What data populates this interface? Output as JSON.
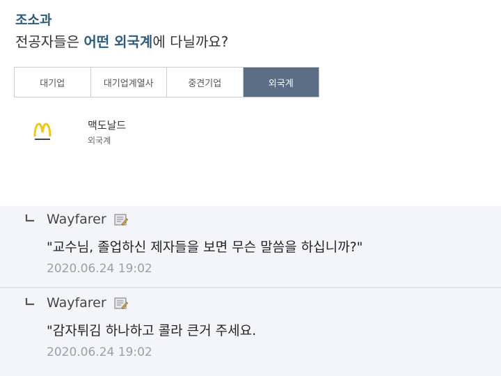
{
  "header": {
    "department": "조소과",
    "question_prefix": "전공자들은 ",
    "question_highlight": "어떤 외국계",
    "question_suffix": "에 다닐까요?"
  },
  "tabs": [
    {
      "label": "대기업",
      "active": false
    },
    {
      "label": "대기업계열사",
      "active": false
    },
    {
      "label": "중견기업",
      "active": false
    },
    {
      "label": "외국계",
      "active": true
    }
  ],
  "company": {
    "name": "맥도날드",
    "type": "외국계",
    "logo_icon": "mcdonalds-logo",
    "logo_color": "#f6c412"
  },
  "comments": [
    {
      "author": "Wayfarer",
      "text": "\"교수님, 졸업하신 제자들을 보면 무슨 말씀을 하십니까?\"",
      "date": "2020.06.24 19:02"
    },
    {
      "author": "Wayfarer",
      "text": "\"감자튀김 하나하고 콜라 큰거 주세요.",
      "date": "2020.06.24 19:02"
    }
  ],
  "colors": {
    "accent": "#2c5c7e",
    "active_tab": "#5b6e86",
    "comment_bg": "#f4f5f8",
    "date": "#9aa0a8"
  }
}
